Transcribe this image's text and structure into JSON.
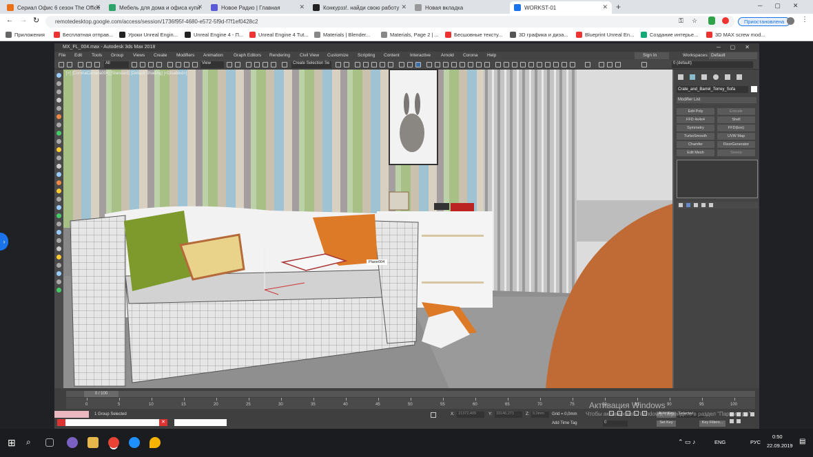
{
  "browser": {
    "tabs": [
      {
        "title": "Сериал Офис 6 сезон The Office",
        "color": "#e8711a"
      },
      {
        "title": "Мебель для дома и офиса купи",
        "color": "#2fa36b"
      },
      {
        "title": "Новое Радио | Главная",
        "color": "#5b5bd6"
      },
      {
        "title": "Конкурзз!. найди свою работу",
        "color": "#222222"
      },
      {
        "title": "Новая вкладка",
        "color": "#999999"
      },
      {
        "title": "WORKST-01",
        "color": "#1a73e8"
      }
    ],
    "url": "remotedesktop.google.com/access/session/1736f95f-4680-e572-5f9d-f7f1ef0428c2",
    "profile_status": "Приостановлена",
    "bookmarks": [
      "Приложения",
      "Бесплатная отправ...",
      "Уроки Unreal Engin...",
      "Unreal Engine 4 - П...",
      "Unreal Engine 4 Tut...",
      "Materials | Blender...",
      "Materials, Page 2 | ...",
      "Бесшовные тексту...",
      "3D графика и диза...",
      "Blueprint Unreal En...",
      "Создание интерье...",
      "3D MAX screw mod..."
    ]
  },
  "max": {
    "window_title": "MX_FL_004.max - Autodesk 3ds Max 2018",
    "menu": [
      "File",
      "Edit",
      "Tools",
      "Group",
      "Views",
      "Create",
      "Modifiers",
      "Animation",
      "Graph Editors",
      "Rendering",
      "Civil View",
      "Customize",
      "Scripting",
      "Content",
      "Interactive",
      "Arnold",
      "Corona",
      "Help"
    ],
    "sign_in": "Sign In",
    "workspaces_label": "Workspaces:",
    "workspace": "Default",
    "view_dropdown": "View",
    "selection_set": "Create Selection Se",
    "filter": "All",
    "layer": "0 (default)",
    "viewport_label": "[+] [CoronaCamera004] [Standard] [Default Shading] [<Disabled>]",
    "object_tag": "Plane004",
    "object_name": "Crate_and_Barrel_Torrey_Sofa",
    "modifier_list": "Modifier List",
    "modifiers": [
      "Edit Poly",
      "Extrude",
      "FFD 4x4x4",
      "Shell",
      "Symmetry",
      "FFD(box)",
      "TurboSmooth",
      "UVW Map",
      "Chamfer",
      "FloorGenerator",
      "Edit Mesh",
      "Sweep"
    ],
    "time_range": "0 / 100",
    "ticks": [
      "0",
      "5",
      "10",
      "15",
      "20",
      "25",
      "30",
      "35",
      "40",
      "45",
      "50",
      "55",
      "60",
      "65",
      "70",
      "75",
      "80",
      "85",
      "90",
      "95",
      "100"
    ],
    "status": "1 Group Selected",
    "x_label": "X:",
    "x_value": "21372,409",
    "y_label": "Y:",
    "y_value": "33146,271",
    "z_label": "Z:",
    "z_value": "0,0mm",
    "grid": "Grid = 0,0mm",
    "add_time_tag": "Add Time Tag",
    "auto_key": "Auto Key",
    "set_key": "Set Key",
    "selected": "Selected",
    "key_filters": "Key Filters...",
    "frame": "0"
  },
  "windows": {
    "activation_title": "Активация Windows",
    "activation_sub": "Чтобы активировать Windows, перейдите в раздел \"Параметры\".",
    "lang": "ENG",
    "tray_lang": "РУС",
    "time": "0:50",
    "date": "22.09.2019"
  }
}
